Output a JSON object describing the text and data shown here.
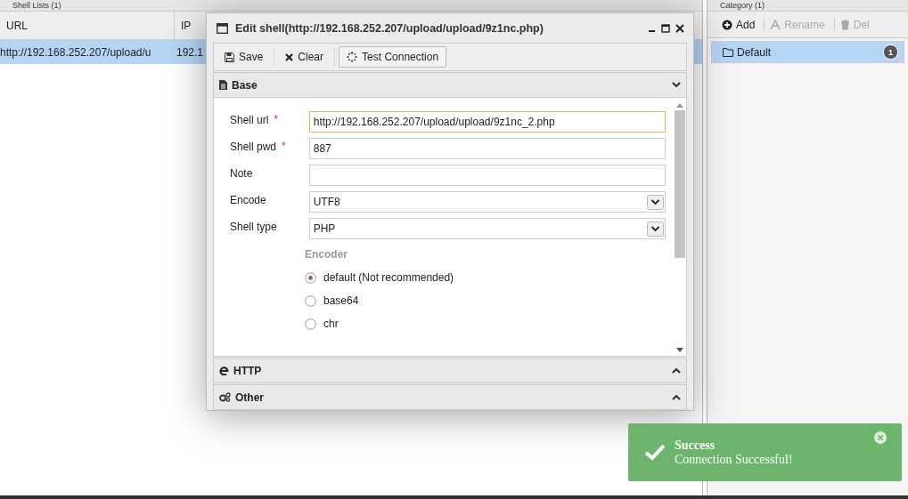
{
  "shell_list": {
    "title": "Shell Lists (1)",
    "columns": [
      "URL",
      "IP"
    ],
    "rows": [
      {
        "cells": [
          "http://192.168.252.207/upload/u",
          "192.1"
        ],
        "selected": true
      }
    ]
  },
  "category": {
    "title": "Category (1)",
    "toolbar": [
      {
        "label": "Add",
        "disabled": false
      },
      {
        "label": "Rename",
        "disabled": true
      },
      {
        "label": "Del",
        "disabled": true
      }
    ],
    "items": [
      {
        "label": "Default",
        "count": "1",
        "selected": true
      }
    ]
  },
  "dialog": {
    "title": "Edit shell(http://192.168.252.207/upload/upload/9z1nc.php)",
    "toolbar": [
      "Save",
      "Clear",
      "Test Connection"
    ],
    "sections": [
      {
        "title": "Base",
        "expanded": true
      },
      {
        "title": "HTTP",
        "expanded": false
      },
      {
        "title": "Other",
        "expanded": false
      }
    ],
    "fields": [
      {
        "label": "Shell url",
        "required": true,
        "kind": "text",
        "value": "http://192.168.252.207/upload/upload/9z1nc_2.php",
        "focused": true
      },
      {
        "label": "Shell pwd",
        "required": true,
        "kind": "text",
        "value": "887",
        "focused": false
      },
      {
        "label": "Note",
        "required": false,
        "kind": "text",
        "focused": false
      },
      {
        "label": "Encode",
        "required": false,
        "kind": "select",
        "value": "UTF8",
        "focused": false
      },
      {
        "label": "Shell type",
        "required": false,
        "kind": "select",
        "value": "PHP",
        "focused": false
      }
    ],
    "required_mark": "*",
    "encoder": {
      "title": "Encoder",
      "options": [
        {
          "label": "default (Not recommended)",
          "selected": true
        },
        {
          "label": "base64",
          "selected": false
        },
        {
          "label": "chr",
          "selected": false
        }
      ]
    }
  },
  "toast": {
    "title": "Success",
    "message": "Connection Successful!"
  }
}
